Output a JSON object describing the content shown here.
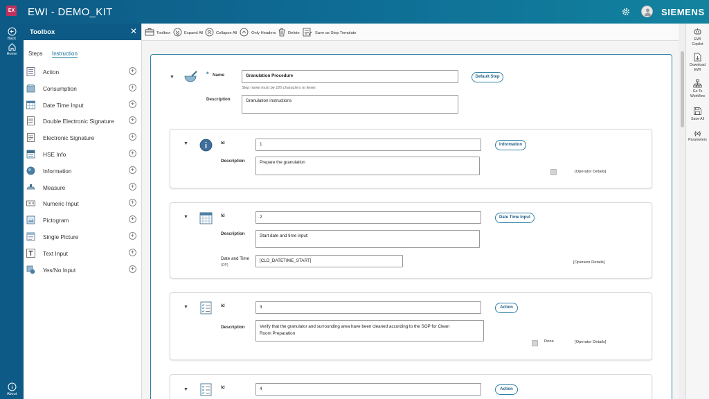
{
  "header": {
    "logo": "EX",
    "title": "EWI - DEMO_KIT",
    "brand": "SIEMENS"
  },
  "leftrail": {
    "back": "Back",
    "home": "Home",
    "about": "About"
  },
  "toolbox": {
    "title": "Toolbox",
    "tabs": [
      "Steps",
      "Instruction"
    ],
    "items": [
      {
        "label": "Action",
        "icon": "checklist-icon"
      },
      {
        "label": "Consumption",
        "icon": "box-icon"
      },
      {
        "label": "Date Time Input",
        "icon": "calendar-icon"
      },
      {
        "label": "Double Electronic Signature",
        "icon": "signature-icon"
      },
      {
        "label": "Electronic Signature",
        "icon": "signature-icon"
      },
      {
        "label": "HSE Info",
        "icon": "hse-icon"
      },
      {
        "label": "Information",
        "icon": "info-icon"
      },
      {
        "label": "Measure",
        "icon": "scale-icon"
      },
      {
        "label": "Numeric Input",
        "icon": "numeric-icon"
      },
      {
        "label": "Pictogram",
        "icon": "pictogram-icon"
      },
      {
        "label": "Single Picture",
        "icon": "picture-icon"
      },
      {
        "label": "Text Input",
        "icon": "text-icon"
      },
      {
        "label": "Yes/No Input",
        "icon": "yesno-icon"
      }
    ]
  },
  "actions": {
    "toolbox": "Toolbox",
    "expand": "Expand All",
    "collapse": "Collapse All",
    "headers": "Only Headers",
    "delete": "Delete",
    "template": "Save as Step Template"
  },
  "step": {
    "name_label": "Name",
    "name_value": "Granulation Procedure",
    "name_hint": "Step name must be 120 characters or fewer.",
    "default_step": "Default Step",
    "desc_label": "Description",
    "desc_value": "Granulation instructions"
  },
  "cards": [
    {
      "id_label": "Id",
      "id_value": "1",
      "type": "Information",
      "desc_label": "Description",
      "desc_value": "Prepare the granulation",
      "operator": "[Operator Details]"
    },
    {
      "id_label": "Id",
      "id_value": "2",
      "type": "Date Time Input",
      "desc_label": "Description",
      "desc_value": "Start date and time input:",
      "dt_label": "Date and Time",
      "dt_sub": "(OP)",
      "dt_value": "[CLD_DATETIME_START]",
      "operator": "[Operator Details]"
    },
    {
      "id_label": "Id",
      "id_value": "3",
      "type": "Action",
      "desc_label": "Description",
      "desc_value_1": "Verify that the granulator and surrounding area have been cleaned according to the SOP for Clean",
      "desc_value_2": "Room Preparation",
      "done": "Done",
      "operator": "[Operator Details]"
    },
    {
      "id_label": "Id",
      "id_value": "4",
      "type": "Action"
    }
  ],
  "rightrail": {
    "copilot": [
      "EWI",
      "Copilot"
    ],
    "download": [
      "Download",
      "EWI"
    ],
    "workflow": [
      "Go To",
      "Workflow"
    ],
    "save": "Save All",
    "params": "Parameters"
  },
  "colors": {
    "primary": "#0d5a86",
    "accent": "#2c7fa6"
  }
}
